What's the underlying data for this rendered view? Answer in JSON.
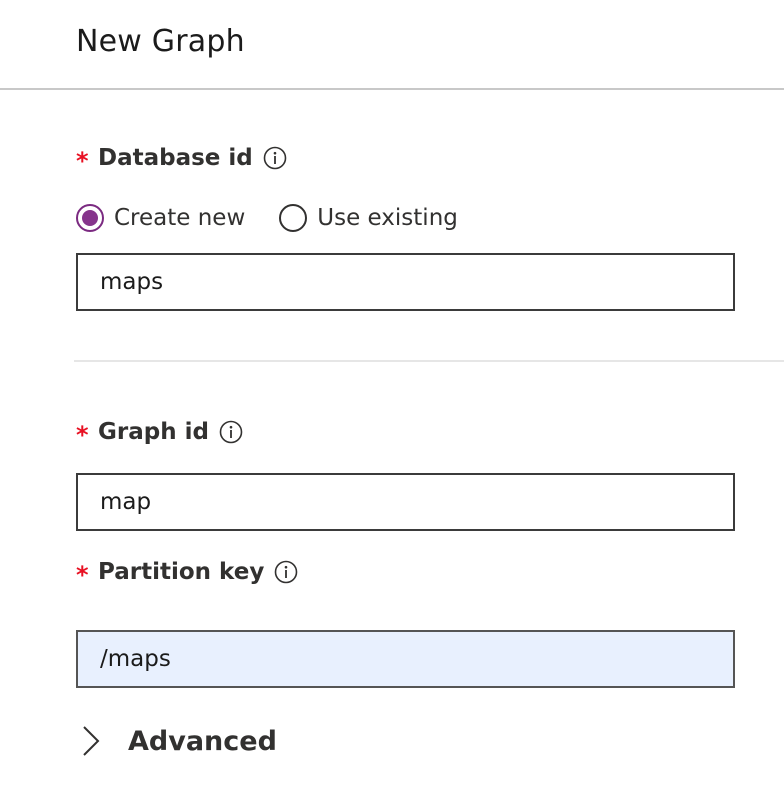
{
  "panel": {
    "title": "New Graph"
  },
  "database": {
    "required_mark": "*",
    "label": "Database id",
    "info_icon": "info-icon",
    "options": [
      {
        "label": "Create new",
        "selected": true
      },
      {
        "label": "Use existing",
        "selected": false
      }
    ],
    "value": "maps"
  },
  "graph": {
    "required_mark": "*",
    "label": "Graph id",
    "info_icon": "info-icon",
    "value": "map"
  },
  "partition": {
    "required_mark": "*",
    "label": "Partition key",
    "info_icon": "info-icon",
    "value": "/maps"
  },
  "advanced": {
    "label": "Advanced",
    "icon": "chevron-right-icon",
    "expanded": false
  },
  "colors": {
    "required": "#e81123",
    "radio_accent": "#86358c",
    "autofill_background": "#e8f0fe"
  }
}
